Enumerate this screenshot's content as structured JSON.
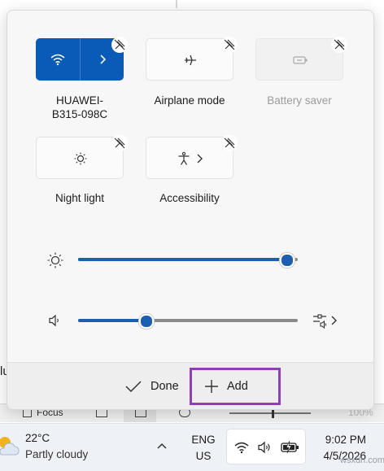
{
  "quick_settings": {
    "tiles": [
      {
        "id": "wifi",
        "label": "HUAWEI-\nB315-098C",
        "active": true,
        "has_chevron": true
      },
      {
        "id": "airplane",
        "label": "Airplane mode",
        "active": false
      },
      {
        "id": "battery-saver",
        "label": "Battery saver",
        "active": false,
        "disabled": true
      },
      {
        "id": "night-light",
        "label": "Night light",
        "active": false
      },
      {
        "id": "accessibility",
        "label": "Accessibility",
        "active": false,
        "has_chevron": true
      }
    ],
    "brightness": {
      "level": 0.95
    },
    "volume": {
      "level": 0.31
    },
    "footer": {
      "done_label": "Done",
      "add_label": "Add"
    }
  },
  "background_window": {
    "partial_text": "lu",
    "status_focus": "Focus",
    "status_zoom": "100%"
  },
  "taskbar": {
    "weather_temp": "22°C",
    "weather_desc": "Partly cloudy",
    "lang_line1": "ENG",
    "lang_line2": "US",
    "time": "9:02 PM",
    "date": "4/5/2026"
  },
  "watermark": "wsxdn.com",
  "colors": {
    "accent": "#1c5fb0",
    "wifi_tile": "#0a5bb8",
    "highlight": "#8e3fb8"
  }
}
